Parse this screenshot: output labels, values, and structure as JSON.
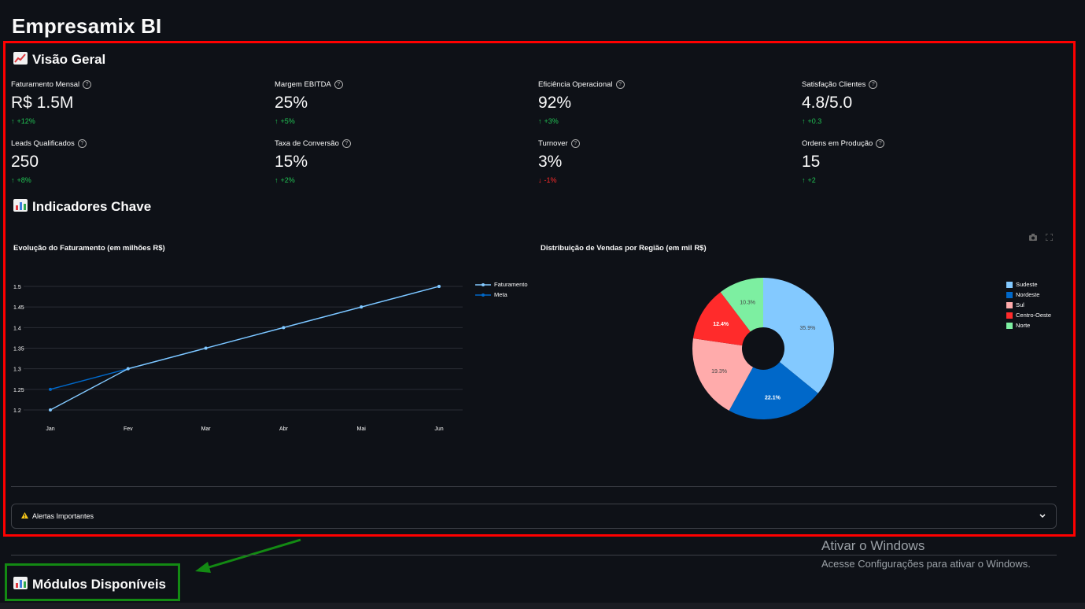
{
  "app_title": "Empresamix BI",
  "overview": {
    "icon": "chart-increasing-icon",
    "title": "Visão Geral",
    "metrics": [
      {
        "label": "Faturamento Mensal",
        "value": "R$ 1.5M",
        "delta": "+12%",
        "direction": "up"
      },
      {
        "label": "Margem EBITDA",
        "value": "25%",
        "delta": "+5%",
        "direction": "up"
      },
      {
        "label": "Eficiência Operacional",
        "value": "92%",
        "delta": "+3%",
        "direction": "up"
      },
      {
        "label": "Satisfação Clientes",
        "value": "4.8/5.0",
        "delta": "+0.3",
        "direction": "up"
      },
      {
        "label": "Leads Qualificados",
        "value": "250",
        "delta": "+8%",
        "direction": "up"
      },
      {
        "label": "Taxa de Conversão",
        "value": "15%",
        "delta": "+2%",
        "direction": "up"
      },
      {
        "label": "Turnover",
        "value": "3%",
        "delta": "-1%",
        "direction": "down"
      },
      {
        "label": "Ordens em Produção",
        "value": "15",
        "delta": "+2",
        "direction": "up"
      }
    ]
  },
  "indicators": {
    "icon": "bar-chart-icon",
    "title": "Indicadores Chave"
  },
  "chart_data": [
    {
      "type": "line",
      "title": "Evolução do Faturamento (em milhões R$)",
      "categories": [
        "Jan",
        "Fev",
        "Mar",
        "Abr",
        "Mai",
        "Jun"
      ],
      "series": [
        {
          "name": "Faturamento",
          "values": [
            1.2,
            1.3,
            1.35,
            1.4,
            1.45,
            1.5
          ],
          "color": "#83c9ff"
        },
        {
          "name": "Meta",
          "values": [
            1.25,
            1.3,
            1.35,
            1.4,
            1.45,
            1.5
          ],
          "color": "#0068c9"
        }
      ],
      "yticks": [
        "1.2",
        "1.25",
        "1.3",
        "1.35",
        "1.4",
        "1.45",
        "1.5"
      ],
      "ylim": [
        1.2,
        1.5
      ]
    },
    {
      "type": "pie",
      "title": "Distribuição de Vendas por Região (em mil R$)",
      "labels": [
        "Sudeste",
        "Nordeste",
        "Sul",
        "Centro-Oeste",
        "Norte"
      ],
      "values": [
        35.9,
        22.1,
        19.3,
        12.4,
        10.3
      ],
      "value_labels": [
        "35.9%",
        "22.1%",
        "19.3%",
        "12.4%",
        "10.3%"
      ],
      "colors": [
        "#83c9ff",
        "#0068c9",
        "#ffabab",
        "#ff2b2b",
        "#7defa1"
      ],
      "legend": "right"
    }
  ],
  "alerts": {
    "icon": "warning-icon",
    "label": "Alertas Importantes",
    "chevron": "chevron-down-icon"
  },
  "modules": {
    "icon": "bar-chart-icon",
    "title": "Módulos Disponíveis"
  },
  "windows_watermark": {
    "title": "Ativar o Windows",
    "subtitle": "Acesse Configurações para ativar o Windows."
  },
  "colors": {
    "background": "#0e1117",
    "annotation_red": "#ff0000",
    "annotation_green": "#138a13",
    "positive": "#21c354",
    "negative": "#ff2b2b"
  }
}
